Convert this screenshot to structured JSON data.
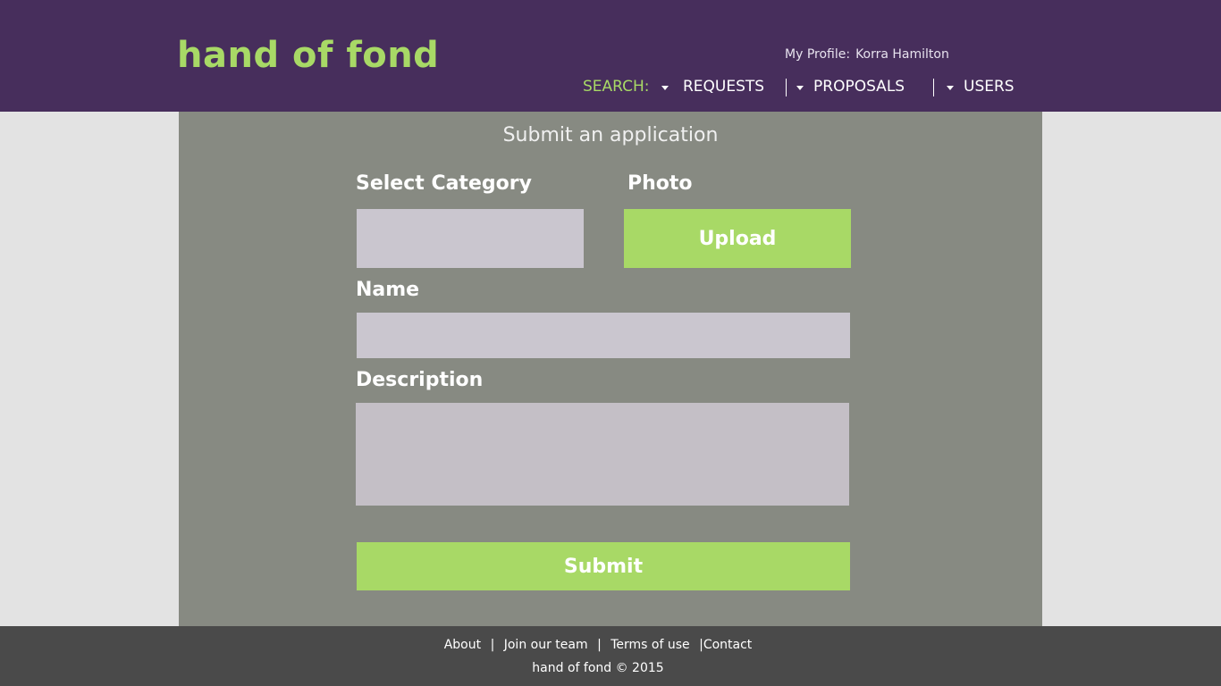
{
  "header": {
    "logo": "hand of fond",
    "profile_label": "My Profile:",
    "profile_name": "Korra Hamilton",
    "search_label": "SEARCH:",
    "nav": [
      {
        "label": "REQUESTS"
      },
      {
        "label": "PROPOSALS"
      },
      {
        "label": "USERS"
      }
    ]
  },
  "form": {
    "title": "Submit an application",
    "category_label": "Select Category",
    "category_value": "",
    "photo_label": "Photo",
    "upload_button": "Upload",
    "name_label": "Name",
    "name_value": "",
    "description_label": "Description",
    "description_value": "",
    "submit_button": "Submit"
  },
  "footer": {
    "links": [
      "About",
      "Join our team",
      "Terms of use",
      "Contact"
    ],
    "separator": "|",
    "copyright": "hand of fond © 2015"
  },
  "colors": {
    "header_bg": "#472e5c",
    "accent": "#a8d966",
    "panel_bg": "#878a82",
    "field_bg": "#cac6cf",
    "footer_bg": "#4a4a4a",
    "page_bg": "#e3e3e3"
  }
}
